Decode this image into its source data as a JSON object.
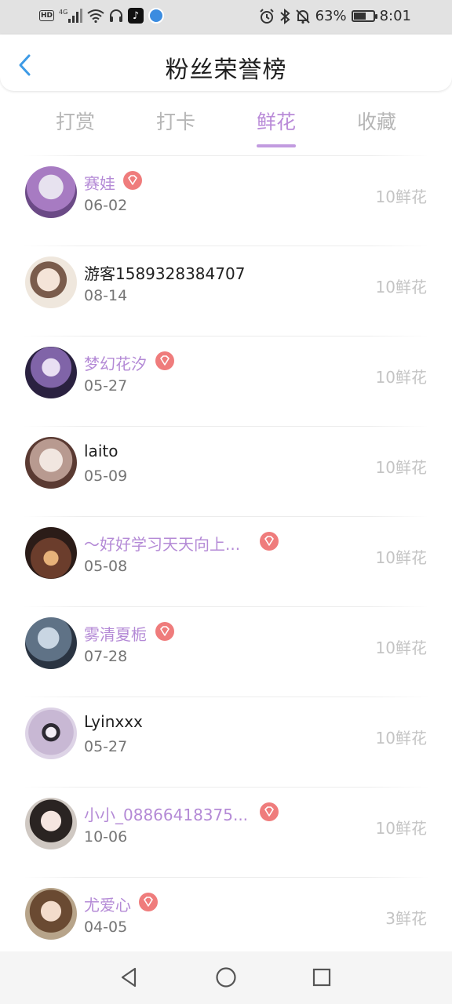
{
  "status_bar": {
    "network": "4G",
    "hd_label": "HD",
    "battery_percent": "63%",
    "battery_level": 0.63,
    "time": "8:01",
    "icons": [
      "hd-icon",
      "signal-icon",
      "wifi-icon",
      "headphones-icon",
      "tiktok-icon",
      "app-icon",
      "alarm-icon",
      "bluetooth-icon",
      "mute-icon",
      "battery-icon"
    ]
  },
  "header": {
    "title": "粉丝荣誉榜",
    "back_icon": "chevron-left-icon"
  },
  "tabs": [
    {
      "label": "打赏",
      "active": false
    },
    {
      "label": "打卡",
      "active": false
    },
    {
      "label": "鲜花",
      "active": true
    },
    {
      "label": "收藏",
      "active": false
    }
  ],
  "colors": {
    "accent": "#b98ad8",
    "vip_name": "#b48ad6",
    "vip_badge": "#ef7c7c",
    "muted_text": "#c4c4c4"
  },
  "fans": [
    {
      "name": "赛娃",
      "date": "06-02",
      "amount": "10鲜花",
      "vip": true
    },
    {
      "name": "游客1589328384707",
      "date": "08-14",
      "amount": "10鲜花",
      "vip": false
    },
    {
      "name": "梦幻花汐",
      "date": "05-27",
      "amount": "10鲜花",
      "vip": true
    },
    {
      "name": "laito",
      "date": "05-09",
      "amount": "10鲜花",
      "vip": false
    },
    {
      "name": "～好好学习天天向上...",
      "date": "05-08",
      "amount": "10鲜花",
      "vip": true
    },
    {
      "name": "雾清夏栀",
      "date": "07-28",
      "amount": "10鲜花",
      "vip": true
    },
    {
      "name": "Lyinxxx",
      "date": "05-27",
      "amount": "10鲜花",
      "vip": false
    },
    {
      "name": "小小_08866418375...",
      "date": "10-06",
      "amount": "10鲜花",
      "vip": true
    },
    {
      "name": "尤爱心",
      "date": "04-05",
      "amount": "3鲜花",
      "vip": true
    }
  ],
  "nav_bar": {
    "icons": [
      "back-triangle-icon",
      "home-circle-icon",
      "recents-square-icon"
    ]
  }
}
